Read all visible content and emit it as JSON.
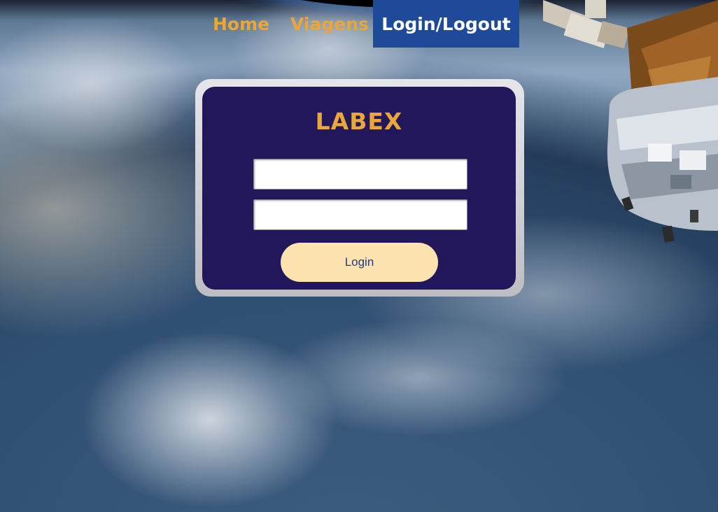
{
  "nav": {
    "home_label": "Home",
    "trips_label": "Viagens",
    "login_logout_label": "Login/Logout",
    "accent_color": "#e8a63c",
    "active_bg_color": "#1f4a9a"
  },
  "login_card": {
    "brand": "LABEX",
    "username_value": "",
    "password_value": "",
    "submit_label": "Login",
    "card_color": "#22175a",
    "button_color": "#fde3b0"
  },
  "background": {
    "icons": [
      "earth-from-space-image",
      "satellite-image"
    ]
  }
}
